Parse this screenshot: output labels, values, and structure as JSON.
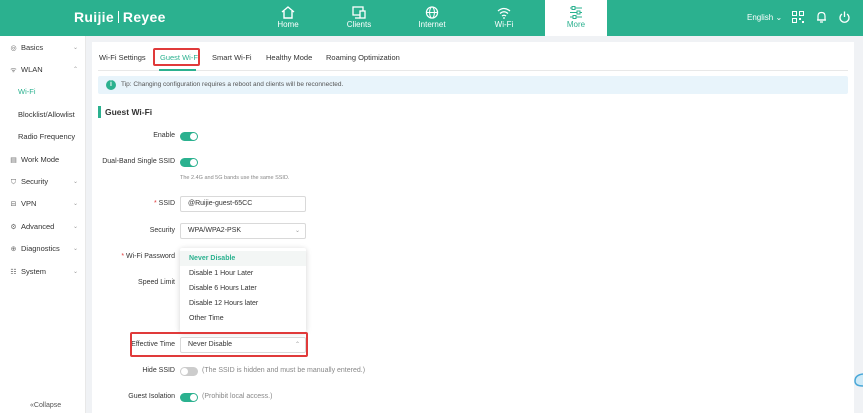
{
  "header": {
    "brand": "Ruijie",
    "brand_sub": "Reyee",
    "nav": [
      {
        "label": "Home",
        "icon": "home-icon"
      },
      {
        "label": "Clients",
        "icon": "clients-icon"
      },
      {
        "label": "Internet",
        "icon": "globe-icon"
      },
      {
        "label": "Wi-Fi",
        "icon": "wifi-icon"
      },
      {
        "label": "More",
        "icon": "more-icon"
      }
    ],
    "active_nav": "More",
    "language": "English",
    "accent": "#2bb18f"
  },
  "sidebar": {
    "items": [
      {
        "label": "Basics"
      },
      {
        "label": "WLAN"
      },
      {
        "label": "Wi-Fi"
      },
      {
        "label": "Blocklist/Allowlist"
      },
      {
        "label": "Radio Frequency"
      },
      {
        "label": "Work Mode"
      },
      {
        "label": "Security"
      },
      {
        "label": "VPN"
      },
      {
        "label": "Advanced"
      },
      {
        "label": "Diagnostics"
      },
      {
        "label": "System"
      }
    ],
    "collapse_label": "Collapse"
  },
  "tabs": [
    {
      "label": "Wi-Fi Settings"
    },
    {
      "label": "Guest Wi-Fi"
    },
    {
      "label": "Smart Wi-Fi"
    },
    {
      "label": "Healthy Mode"
    },
    {
      "label": "Roaming Optimization"
    }
  ],
  "tip": "Tip: Changing configuration requires a reboot and clients will be reconnected.",
  "section_title": "Guest Wi-Fi",
  "form": {
    "enable_label": "Enable",
    "enable_on": true,
    "dualband_label": "Dual-Band Single SSID",
    "dualband_on": true,
    "dualband_hint": "The 2.4G and 5G bands use the same SSID.",
    "ssid_label": "SSID",
    "ssid_value": "@Ruijie-guest-65CC",
    "security_label": "Security",
    "security_value": "WPA/WPA2-PSK",
    "password_label": "Wi-Fi Password",
    "speed_label": "Speed Limit",
    "effective_label": "Effective Time",
    "effective_value": "Never Disable",
    "effective_options": [
      "Never Disable",
      "Disable 1 Hour Later",
      "Disable 6 Hours Later",
      "Disable 12 Hours later",
      "Other Time"
    ],
    "hide_ssid_label": "Hide SSID",
    "hide_ssid_on": false,
    "hide_ssid_note": "(The SSID is hidden and must be manually entered.)",
    "isolation_label": "Guest Isolation",
    "isolation_on": true,
    "isolation_note": "(Prohibit local access.)"
  }
}
